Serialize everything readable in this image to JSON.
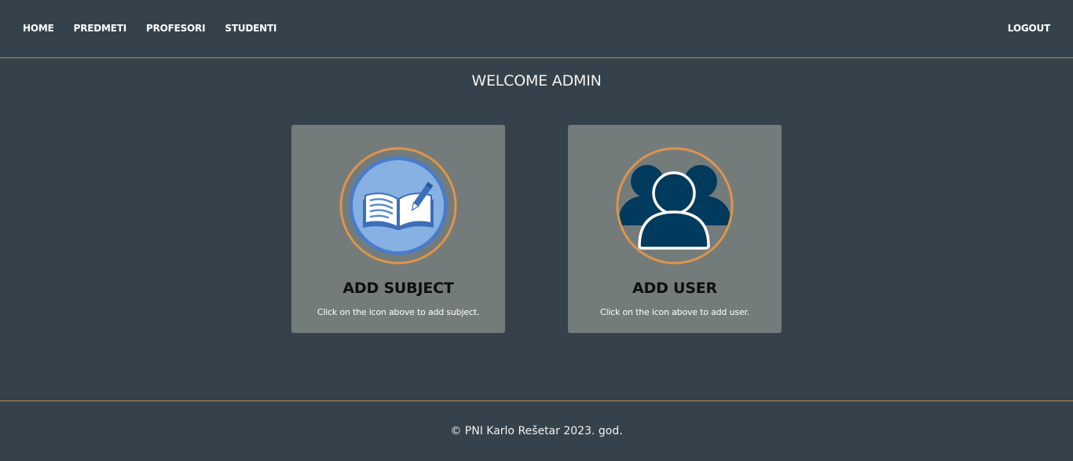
{
  "nav": {
    "items": [
      {
        "label": "HOME"
      },
      {
        "label": "PREDMETI"
      },
      {
        "label": "PROFESORI"
      },
      {
        "label": "STUDENTI"
      }
    ],
    "logout": "LOGOUT"
  },
  "main": {
    "welcome": "WELCOME ADMIN",
    "cards": [
      {
        "title": "ADD SUBJECT",
        "description": "Click on the icon above to add subject.",
        "icon": "book-icon"
      },
      {
        "title": "ADD USER",
        "description": "Click on the icon above to add user.",
        "icon": "users-icon"
      }
    ]
  },
  "footer": {
    "text": "© PNI Karlo Rešetar 2023. god."
  },
  "colors": {
    "background": "#36424b",
    "accent_border": "#c98a4a",
    "card_background": "#747c7b",
    "icon_ring": "#e0944a",
    "book_blue": "#4a7cc7",
    "users_navy": "#003a5c"
  }
}
